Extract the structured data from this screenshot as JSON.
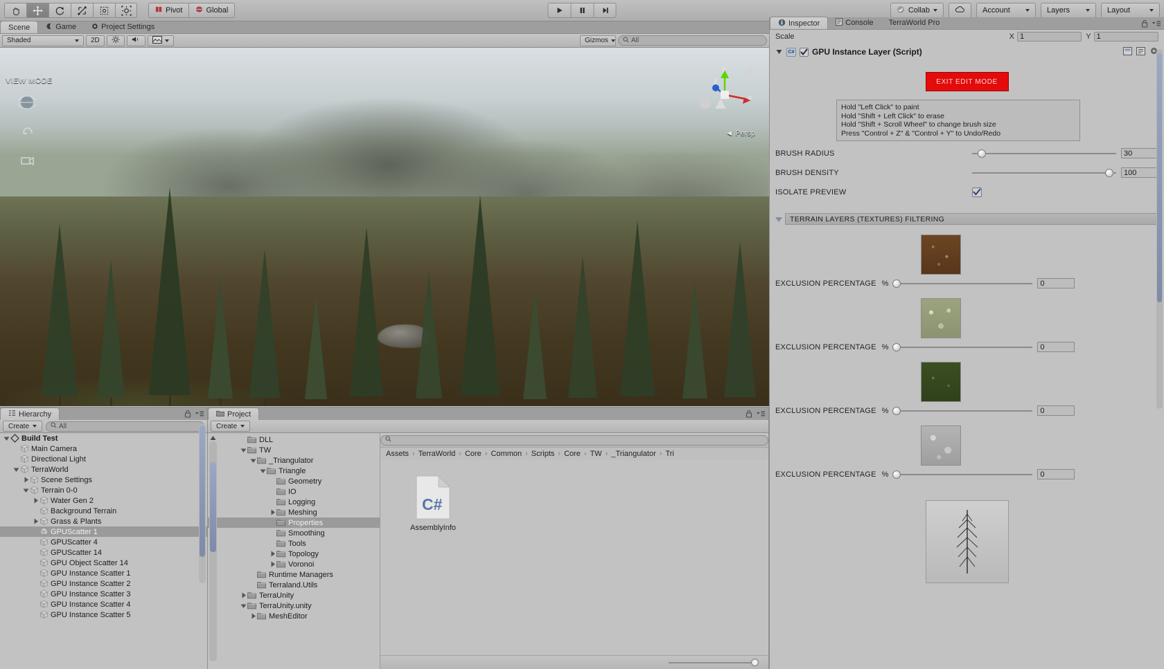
{
  "toolbar": {
    "tools": [
      {
        "name": "hand-tool",
        "icon": "hand-icon",
        "active": false
      },
      {
        "name": "move-tool",
        "icon": "move-icon",
        "active": true
      },
      {
        "name": "rotate-tool",
        "icon": "rotate-icon",
        "active": false
      },
      {
        "name": "scale-tool",
        "icon": "scale-icon",
        "active": false
      },
      {
        "name": "rect-tool",
        "icon": "rect-icon",
        "active": false
      },
      {
        "name": "transform-tool",
        "icon": "transform-icon",
        "active": false
      }
    ],
    "pivot_label": "Pivot",
    "global_label": "Global",
    "play_label": "play-icon",
    "pause_label": "pause-icon",
    "step_label": "step-icon",
    "collab_label": "Collab",
    "cloud_label": "cloud-icon",
    "account_label": "Account",
    "layers_label": "Layers",
    "layout_label": "Layout"
  },
  "scene": {
    "tabs": [
      {
        "label": "Scene",
        "active": true
      },
      {
        "label": "Game",
        "active": false
      },
      {
        "label": "Project Settings",
        "active": false
      }
    ],
    "draw_mode": "Shaded",
    "two_d_label": "2D",
    "gizmos_label": "Gizmos",
    "search_placeholder": "All",
    "view_mode_label": "VIEW MODE",
    "persp_label": "Persp",
    "axis_x": "x",
    "axis_y": "y",
    "axis_z": "z"
  },
  "hierarchy": {
    "tab_label": "Hierarchy",
    "create_label": "Create",
    "search_placeholder": "All",
    "items": [
      {
        "label": "Build Test",
        "depth": 0,
        "arrow": "down",
        "selected": false,
        "root": true
      },
      {
        "label": "Main Camera",
        "depth": 1,
        "arrow": "none",
        "selected": false
      },
      {
        "label": "Directional Light",
        "depth": 1,
        "arrow": "none",
        "selected": false
      },
      {
        "label": "TerraWorld",
        "depth": 1,
        "arrow": "down",
        "selected": false
      },
      {
        "label": "Scene Settings",
        "depth": 2,
        "arrow": "right",
        "selected": false
      },
      {
        "label": "Terrain 0-0",
        "depth": 2,
        "arrow": "down",
        "selected": false
      },
      {
        "label": "Water Gen 2",
        "depth": 3,
        "arrow": "right",
        "selected": false
      },
      {
        "label": "Background Terrain",
        "depth": 3,
        "arrow": "none",
        "selected": false
      },
      {
        "label": "Grass & Plants",
        "depth": 3,
        "arrow": "right",
        "selected": false
      },
      {
        "label": "GPUScatter 1",
        "depth": 3,
        "arrow": "none",
        "selected": true
      },
      {
        "label": "GPUScatter 4",
        "depth": 3,
        "arrow": "none",
        "selected": false
      },
      {
        "label": "GPUScatter 14",
        "depth": 3,
        "arrow": "none",
        "selected": false
      },
      {
        "label": "GPU Object Scatter 14",
        "depth": 3,
        "arrow": "none",
        "selected": false
      },
      {
        "label": "GPU Instance Scatter 1",
        "depth": 3,
        "arrow": "none",
        "selected": false
      },
      {
        "label": "GPU Instance Scatter 2",
        "depth": 3,
        "arrow": "none",
        "selected": false
      },
      {
        "label": "GPU Instance Scatter 3",
        "depth": 3,
        "arrow": "none",
        "selected": false
      },
      {
        "label": "GPU Instance Scatter 4",
        "depth": 3,
        "arrow": "none",
        "selected": false
      },
      {
        "label": "GPU Instance Scatter 5",
        "depth": 3,
        "arrow": "none",
        "selected": false
      }
    ]
  },
  "project": {
    "tab_label": "Project",
    "create_label": "Create",
    "search_placeholder": "",
    "tree": [
      {
        "label": "DLL",
        "depth": 3,
        "arrow": "none",
        "selected": false
      },
      {
        "label": "TW",
        "depth": 3,
        "arrow": "down",
        "selected": false
      },
      {
        "label": "_Triangulator",
        "depth": 4,
        "arrow": "down",
        "selected": false
      },
      {
        "label": "Triangle",
        "depth": 5,
        "arrow": "down",
        "selected": false
      },
      {
        "label": "Geometry",
        "depth": 6,
        "arrow": "none",
        "selected": false
      },
      {
        "label": "IO",
        "depth": 6,
        "arrow": "none",
        "selected": false
      },
      {
        "label": "Logging",
        "depth": 6,
        "arrow": "none",
        "selected": false
      },
      {
        "label": "Meshing",
        "depth": 6,
        "arrow": "right",
        "selected": false
      },
      {
        "label": "Properties",
        "depth": 6,
        "arrow": "none",
        "selected": true
      },
      {
        "label": "Smoothing",
        "depth": 6,
        "arrow": "none",
        "selected": false
      },
      {
        "label": "Tools",
        "depth": 6,
        "arrow": "none",
        "selected": false
      },
      {
        "label": "Topology",
        "depth": 6,
        "arrow": "right",
        "selected": false
      },
      {
        "label": "Voronoi",
        "depth": 6,
        "arrow": "right",
        "selected": false
      },
      {
        "label": "Runtime Managers",
        "depth": 4,
        "arrow": "none",
        "selected": false
      },
      {
        "label": "Terraland.Utils",
        "depth": 4,
        "arrow": "none",
        "selected": false
      },
      {
        "label": "TerraUnity",
        "depth": 3,
        "arrow": "right",
        "selected": false
      },
      {
        "label": "TerraUnity.unity",
        "depth": 3,
        "arrow": "down",
        "selected": false
      },
      {
        "label": "MeshEditor",
        "depth": 4,
        "arrow": "right",
        "selected": false
      }
    ],
    "breadcrumb": [
      "Assets",
      "TerraWorld",
      "Core",
      "Common",
      "Scripts",
      "Core",
      "TW",
      "_Triangulator",
      "Tri"
    ],
    "assets": [
      {
        "label": "AssemblyInfo",
        "icon": "csharp-script-icon",
        "badge": "C#"
      }
    ]
  },
  "inspector": {
    "tabs": [
      {
        "label": "Inspector",
        "active": true
      },
      {
        "label": "Console",
        "active": false
      },
      {
        "label": "TerraWorld Pro",
        "active": false
      }
    ],
    "clipped_label": "Scale",
    "clipped_x": "X",
    "clipped_x_val": "1",
    "clipped_y": "Y",
    "clipped_y_val": "1",
    "component_title": "GPU Instance Layer (Script)",
    "component_enabled": true,
    "script_badge": "C#",
    "exit_edit_mode_label": "EXIT EDIT MODE",
    "exit_color": "#e40b0b",
    "help_lines": [
      "Hold  \"Left Click\"  to paint",
      "Hold  \"Shift + Left Click\"  to erase",
      "Hold  \"Shift + Scroll Wheel\"  to change brush size",
      "Press  \"Control + Z\"  &  \"Control + Y\"  to Undo/Redo"
    ],
    "brush_radius_label": "BRUSH RADIUS",
    "brush_radius_value": "30",
    "brush_radius_pct": 4,
    "brush_density_label": "BRUSH DENSITY",
    "brush_density_value": "100",
    "brush_density_pct": 98,
    "isolate_preview_label": "ISOLATE PREVIEW",
    "isolate_preview_checked": true,
    "terrain_section_label": "TERRAIN LAYERS (TEXTURES) FILTERING",
    "exclusion_label": "EXCLUSION PERCENTAGE",
    "percent_symbol": "%",
    "layers": [
      {
        "texture": "dirt-texture",
        "exclusion_value": "0",
        "exclusion_pct": 0
      },
      {
        "texture": "moss-texture",
        "exclusion_value": "0",
        "exclusion_pct": 0
      },
      {
        "texture": "grass-texture",
        "exclusion_value": "0",
        "exclusion_pct": 0
      },
      {
        "texture": "rock-texture",
        "exclusion_value": "0",
        "exclusion_pct": 0
      }
    ],
    "mesh_preview_name": "tree-mesh-preview",
    "annotation_color": "#ff0000"
  }
}
